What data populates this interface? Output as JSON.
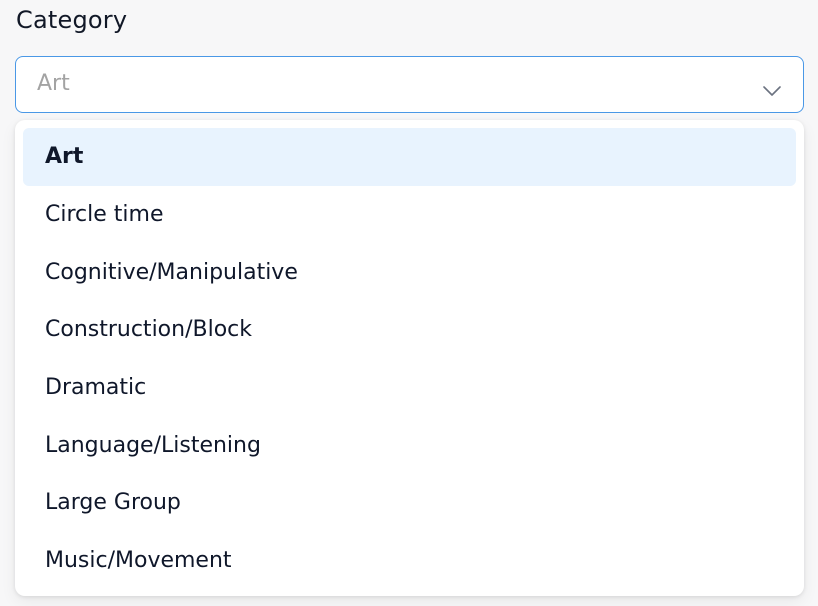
{
  "field": {
    "label": "Category",
    "selected_value": "Art"
  },
  "dropdown": {
    "options": [
      {
        "label": "Art",
        "selected": true
      },
      {
        "label": "Circle time",
        "selected": false
      },
      {
        "label": "Cognitive/Manipulative",
        "selected": false
      },
      {
        "label": "Construction/Block",
        "selected": false
      },
      {
        "label": "Dramatic",
        "selected": false
      },
      {
        "label": "Language/Listening",
        "selected": false
      },
      {
        "label": "Large Group",
        "selected": false
      },
      {
        "label": "Music/Movement",
        "selected": false
      }
    ]
  },
  "icons": {
    "dropdown_chevron": "chevron-down-icon"
  },
  "colors": {
    "focus_border": "#4a98e6",
    "selected_bg": "#e8f3fe",
    "placeholder_text": "#a3a3a3"
  }
}
